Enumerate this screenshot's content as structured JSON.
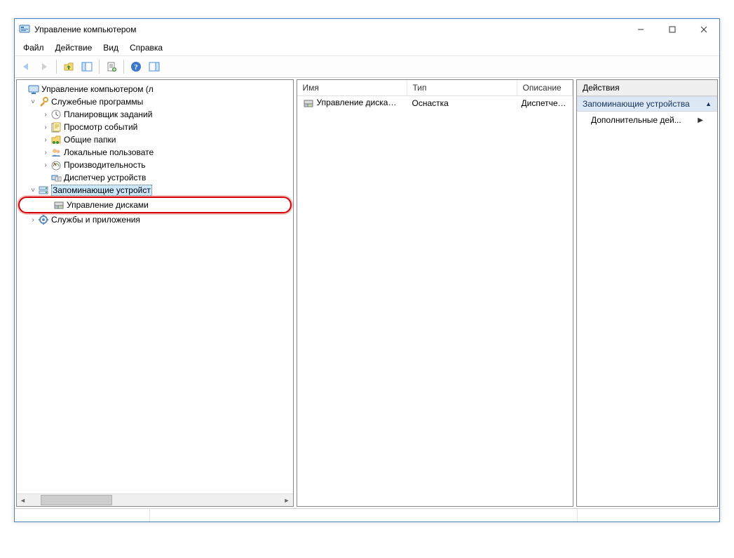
{
  "title": "Управление компьютером",
  "menu": {
    "file": "Файл",
    "action": "Действие",
    "view": "Вид",
    "help": "Справка"
  },
  "tree": {
    "root": "Управление компьютером (л",
    "system_tools": "Служебные программы",
    "task_scheduler": "Планировщик заданий",
    "event_viewer": "Просмотр событий",
    "shared_folders": "Общие папки",
    "local_users": "Локальные пользовате",
    "performance": "Производительность",
    "device_manager": "Диспетчер устройств",
    "storage": "Запоминающие устройст",
    "disk_mgmt": "Управление дисками",
    "services_apps": "Службы и приложения"
  },
  "list": {
    "headers": {
      "name": "Имя",
      "type": "Тип",
      "desc": "Описание"
    },
    "row1": {
      "name": "Управление дисками...",
      "type": "Оснастка",
      "desc": "Диспетчер виртуальны..."
    }
  },
  "actions": {
    "title": "Действия",
    "section": "Запоминающие устройства",
    "more": "Дополнительные дей..."
  }
}
